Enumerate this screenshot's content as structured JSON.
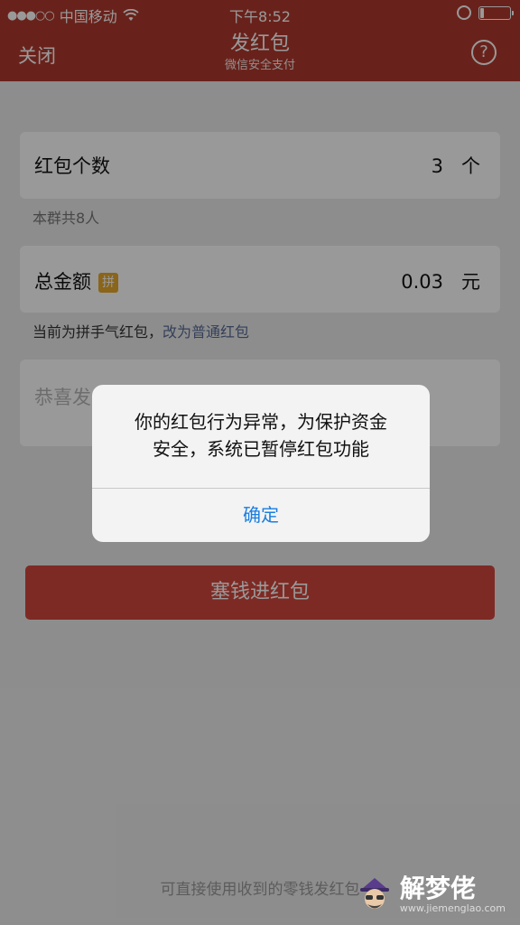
{
  "status_bar": {
    "carrier": "中国移动",
    "signal": "●●●○○",
    "time": "下午8:52"
  },
  "nav": {
    "close_label": "关闭",
    "title": "发红包",
    "subtitle": "微信安全支付",
    "help_label": "?"
  },
  "form": {
    "count_label": "红包个数",
    "count_value": "3",
    "count_unit": "个",
    "count_hint": "本群共8人",
    "amount_label": "总金额",
    "amount_badge": "拼",
    "amount_value": "0.03",
    "amount_unit": "元",
    "amount_hint_prefix": "当前为拼手气红包，",
    "amount_hint_link": "改为普通红包",
    "message_placeholder": "恭喜发",
    "submit_label": "塞钱进红包",
    "footer_note": "可直接使用收到的零钱发红包"
  },
  "alert": {
    "message_line1": "你的红包行为异常，为保护资金",
    "message_line2": "安全，系统已暂停红包功能",
    "confirm_label": "确定"
  },
  "watermark": {
    "text": "解梦佬",
    "url": "www.jiemenglao.com"
  },
  "colors": {
    "header_red": "#b03a2e",
    "button_red": "#d3473c",
    "link_blue": "#576b95",
    "alert_button_blue": "#1a7ee0",
    "badge_gold": "#e7a92c"
  }
}
